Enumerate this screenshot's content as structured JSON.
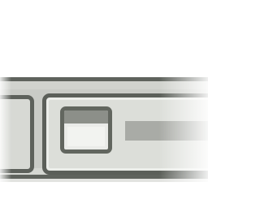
{
  "taskbar": {
    "buttons": [
      {
        "label": "",
        "icon": "window-icon"
      },
      {
        "label": "",
        "icon": "window-icon",
        "state": "active"
      }
    ]
  },
  "colors": {
    "border": "#5f635d",
    "taskbar_fill": "#c9cbc6",
    "button_fill": "#dcded9",
    "icon_titlebar": "#8c8f89",
    "label_placeholder": "#a9aba6"
  }
}
